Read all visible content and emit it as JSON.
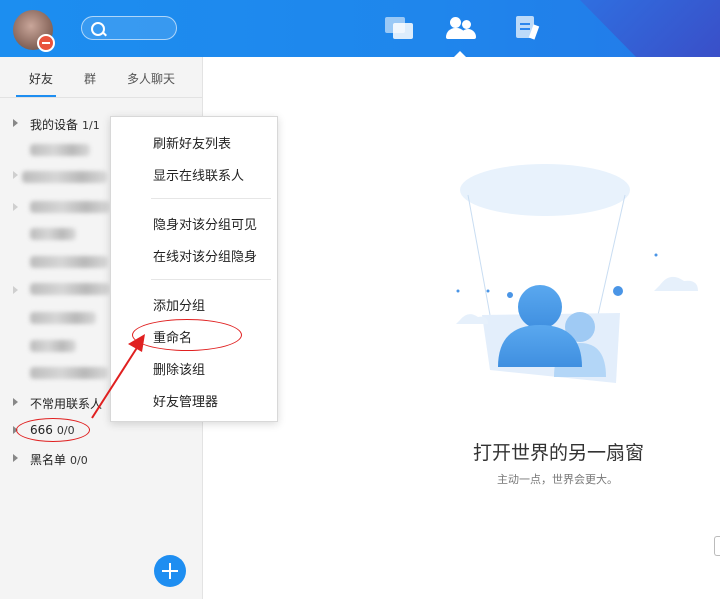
{
  "topbar": {
    "search_placeholder": "",
    "icons": [
      "message-icon",
      "contacts-icon",
      "notes-icon"
    ],
    "accent": "#1e8ef1"
  },
  "sidebar": {
    "tabs": [
      {
        "label": "好友",
        "active": true
      },
      {
        "label": "群",
        "active": false
      },
      {
        "label": "多人聊天",
        "active": false
      }
    ],
    "groups_top": [
      {
        "label": "我的设备",
        "count": "1/1"
      }
    ],
    "groups_bottom": [
      {
        "label": "不常用联系人",
        "count": ""
      },
      {
        "label": "666",
        "count": "0/0"
      },
      {
        "label": "黑名单",
        "count": "0/0"
      }
    ]
  },
  "context_menu": {
    "items": [
      "刷新好友列表",
      "显示在线联系人",
      "隐身对该分组可见",
      "在线对该分组隐身",
      "添加分组",
      "重命名",
      "删除该组",
      "好友管理器"
    ]
  },
  "main": {
    "title": "打开世界的另一扇窗",
    "subtitle": "主动一点，世界会更大。"
  },
  "annotation_color": "#e02020"
}
